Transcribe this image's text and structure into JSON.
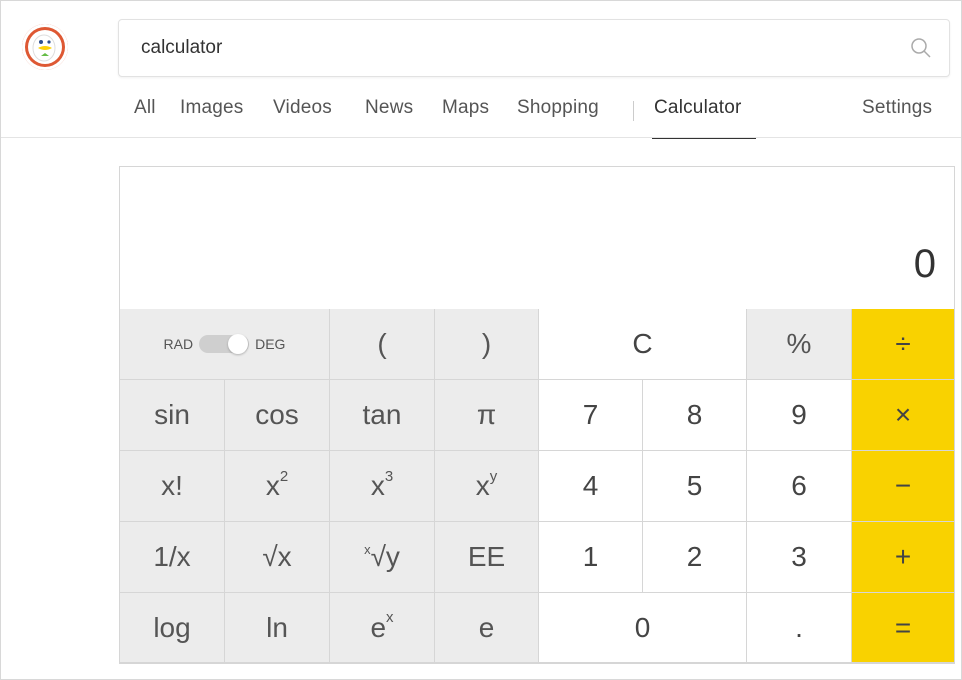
{
  "search": {
    "query": "calculator"
  },
  "nav": {
    "tabs": [
      {
        "label": "All"
      },
      {
        "label": "Images"
      },
      {
        "label": "Videos"
      },
      {
        "label": "News"
      },
      {
        "label": "Maps"
      },
      {
        "label": "Shopping"
      },
      {
        "label": "Calculator"
      }
    ],
    "settings": "Settings",
    "active_tab": "Calculator"
  },
  "calculator": {
    "display": "0",
    "toggle": {
      "left": "RAD",
      "right": "DEG",
      "selected": "DEG"
    },
    "keys": {
      "open_paren": "(",
      "close_paren": ")",
      "clear": "C",
      "percent": "%",
      "divide": "÷",
      "sin": "sin",
      "cos": "cos",
      "tan": "tan",
      "pi": "π",
      "n7": "7",
      "n8": "8",
      "n9": "9",
      "multiply": "×",
      "factorial": "x!",
      "x_base": "x",
      "sq_exp": "2",
      "cube_exp": "3",
      "pow_exp": "y",
      "n4": "4",
      "n5": "5",
      "n6": "6",
      "minus": "−",
      "reciprocal": "1/x",
      "sqrt": "√x",
      "root_x": "x",
      "root_rest": "√y",
      "ee": "EE",
      "n1": "1",
      "n2": "2",
      "n3": "3",
      "plus": "+",
      "log": "log",
      "ln": "ln",
      "e_base": "e",
      "e_exp": "x",
      "e": "e",
      "n0": "0",
      "decimal": ".",
      "equals": "="
    },
    "colors": {
      "operator": "#f9d200",
      "function_key": "#ececec",
      "number_key": "#ffffff"
    }
  }
}
